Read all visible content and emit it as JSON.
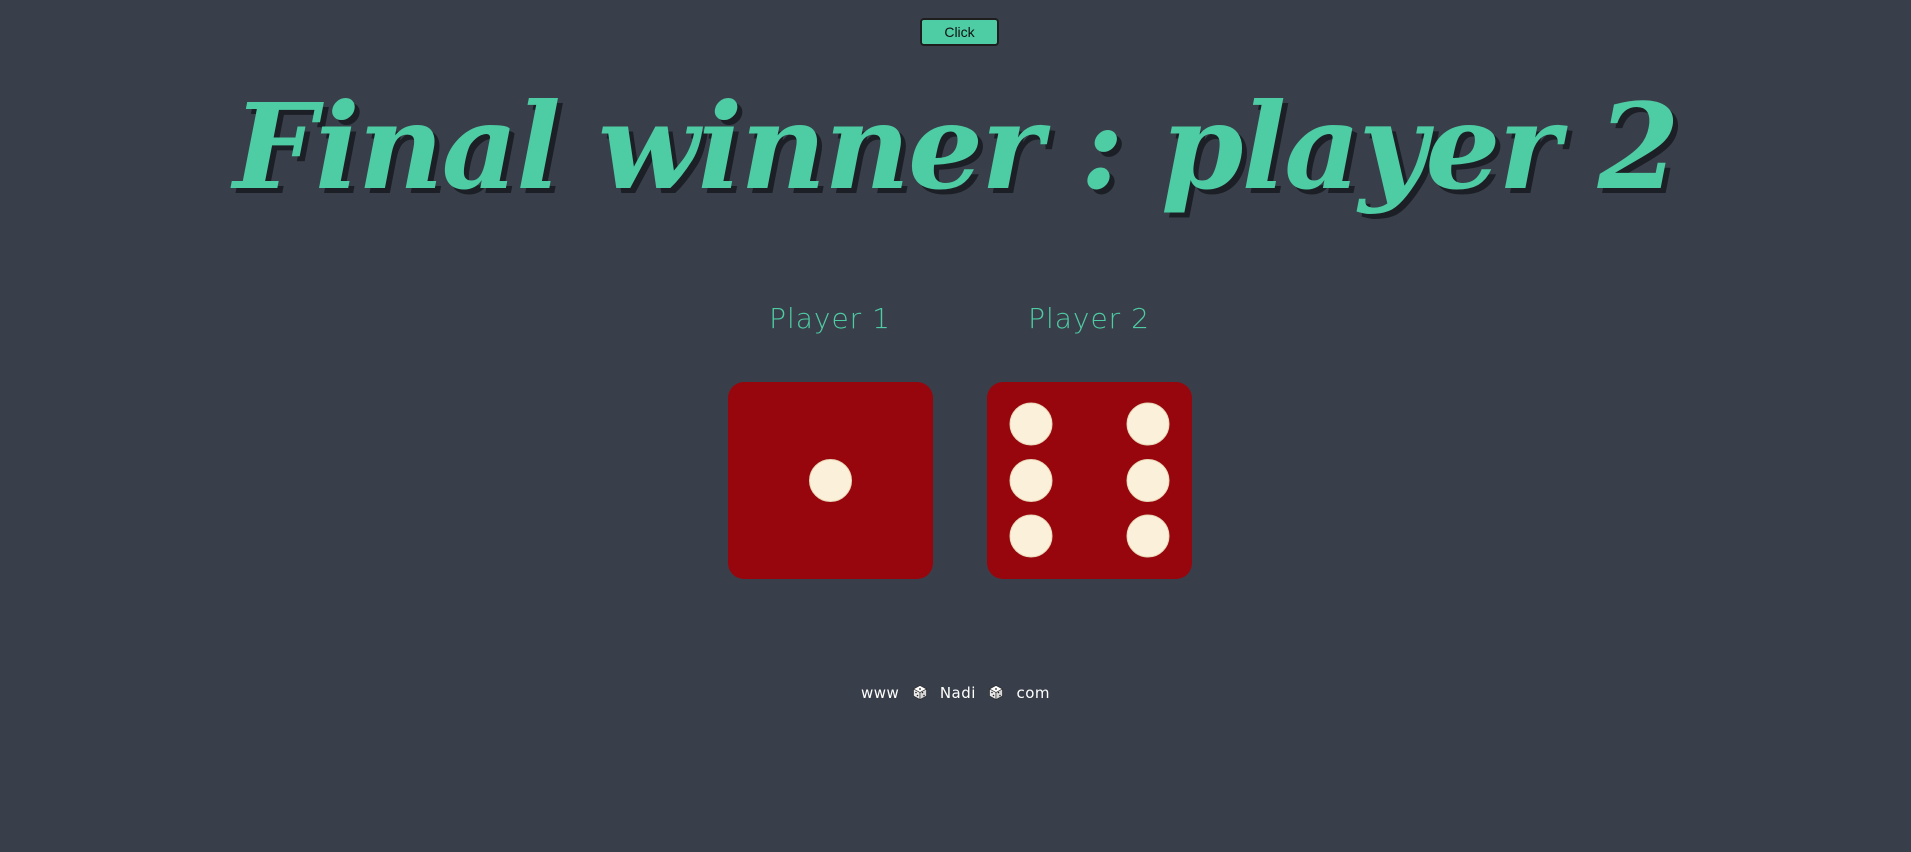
{
  "controls": {
    "click_label": "Click"
  },
  "title": "Final winner : player 2",
  "players": [
    {
      "label": "Player 1",
      "die_value": 1
    },
    {
      "label": "Player 2",
      "die_value": 6
    }
  ],
  "footer": {
    "prefix": "www",
    "name": "Nadi",
    "suffix": "com",
    "separator_icon": "dice-icon"
  },
  "colors": {
    "background": "#393f4a",
    "accent": "#4ecca3",
    "die": "#97060d",
    "pip": "#fbf0d9"
  }
}
